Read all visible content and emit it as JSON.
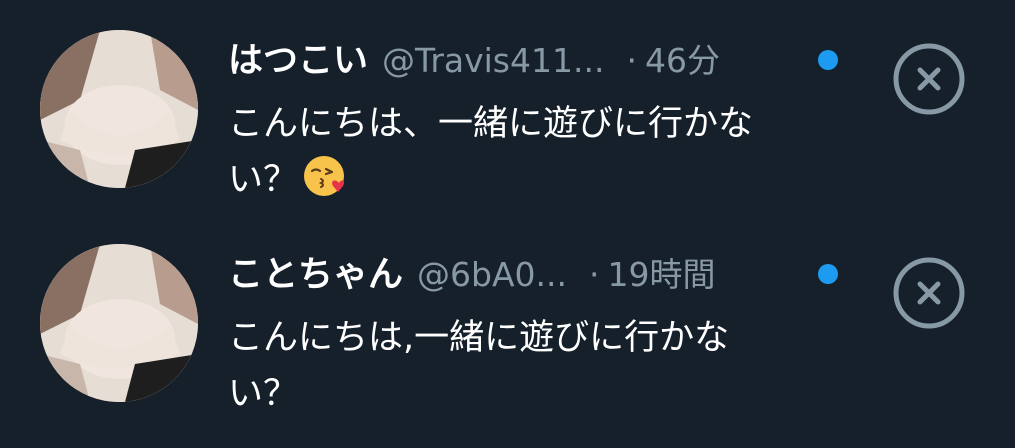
{
  "colors": {
    "background": "#15202b",
    "text_primary": "#ffffff",
    "text_secondary": "#8899a6",
    "unread_dot": "#1d9bf0",
    "dismiss_icon": "#8899a6"
  },
  "messages": [
    {
      "name": "はつこい",
      "handle": "@Travis411...",
      "separator": "·",
      "time": "46分",
      "text": "こんにちは、一緒に遊びに行かない？",
      "emoji": "face-blowing-a-kiss-icon",
      "unread": true,
      "dismiss_icon": "close-circle-icon"
    },
    {
      "name": "ことちゃん",
      "handle": "@6bA0...",
      "separator": "·",
      "time": "19時間",
      "text": "こんにちは,一緒に遊びに行かない？",
      "unread": true,
      "dismiss_icon": "close-circle-icon"
    }
  ]
}
